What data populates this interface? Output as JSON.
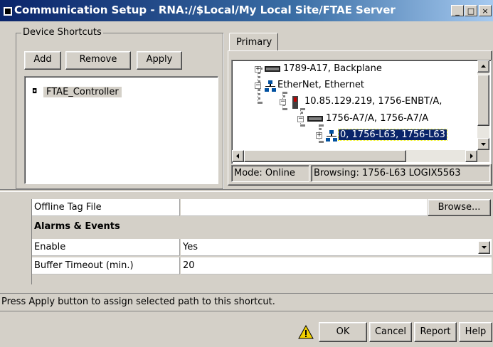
{
  "window": {
    "title": "Communication Setup - RNA://$Local/My Local Site/FTAE Server",
    "controls": {
      "minimize": "_",
      "maximize": "□",
      "close": "×"
    }
  },
  "device_shortcuts": {
    "group_label": "Device Shortcuts",
    "add_label": "Add",
    "remove_label": "Remove",
    "apply_label": "Apply",
    "items": [
      {
        "label": "FTAE_Controller"
      }
    ]
  },
  "tree": {
    "tab_label": "Primary",
    "nodes": [
      {
        "label": "1789-A17, Backplane",
        "icon": "backplane-icon",
        "expander": "+"
      },
      {
        "label": "EtherNet, Ethernet",
        "icon": "network-icon",
        "expander": "−"
      },
      {
        "label": "10.85.129.219, 1756-ENBT/A,",
        "icon": "module-icon",
        "expander": "−"
      },
      {
        "label": "1756-A7/A, 1756-A7/A",
        "icon": "backplane-icon",
        "expander": "−"
      },
      {
        "label": "0, 1756-L63, 1756-L63",
        "icon": "network-icon",
        "expander": "+"
      }
    ],
    "selected_label": "0, 1756-L63, 1756-L63",
    "mode_text": "Mode: Online",
    "browsing_text": "Browsing: 1756-L63 LOGIX5563"
  },
  "properties": {
    "offline_tag_file_label": "Offline Tag File",
    "offline_tag_file_value": "",
    "browse_label": "Browse...",
    "section_title": "Alarms & Events",
    "enable_label": "Enable",
    "enable_value": "Yes",
    "buffer_timeout_label": "Buffer Timeout (min.)",
    "buffer_timeout_value": "20"
  },
  "status_text": "Press Apply button to assign selected path to this shortcut.",
  "footer": {
    "ok_label": "OK",
    "cancel_label": "Cancel",
    "report_label": "Report",
    "help_label": "Help"
  },
  "colors": {
    "selection": "#0a246a",
    "warning": "#f0d000"
  }
}
